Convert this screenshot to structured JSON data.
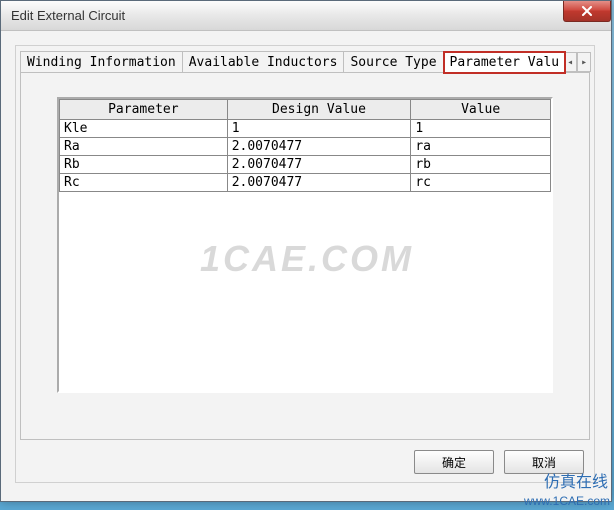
{
  "window": {
    "title": "Edit External Circuit"
  },
  "tabs": {
    "t0": "Winding Information",
    "t1": "Available Inductors",
    "t2": "Source Type",
    "t3": "Parameter Valu"
  },
  "table": {
    "headers": {
      "c0": "Parameter",
      "c1": "Design Value",
      "c2": "Value"
    },
    "rows": [
      {
        "c0": "Kle",
        "c1": "1",
        "c2": "1"
      },
      {
        "c0": "Ra",
        "c1": "2.0070477",
        "c2": "ra"
      },
      {
        "c0": "Rb",
        "c1": "2.0070477",
        "c2": "rb"
      },
      {
        "c0": "Rc",
        "c1": "2.0070477",
        "c2": "rc"
      }
    ]
  },
  "buttons": {
    "ok": "确定",
    "cancel": "取消"
  },
  "watermarks": {
    "center": "1CAE.COM",
    "brand": "仿真在线",
    "url": "www.1CAE.com"
  },
  "nav": {
    "left": "◂",
    "right": "▸"
  }
}
